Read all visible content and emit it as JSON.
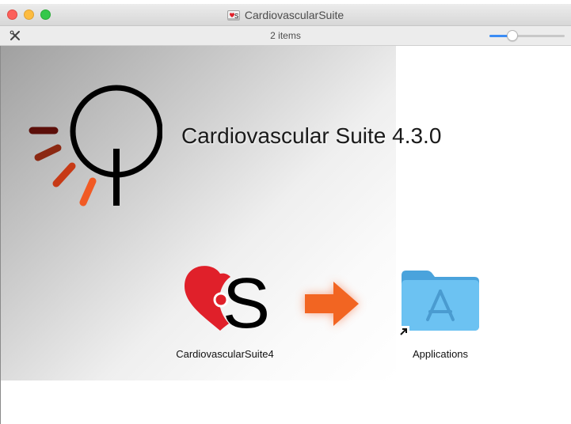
{
  "window": {
    "title": "CardiovascularSuite",
    "item_count": "2 items",
    "icon_size_slider": 0.3
  },
  "installer": {
    "product_title": "Cardiovascular Suite 4.3.0",
    "app_label": "CardiovascularSuite4",
    "folder_label": "Applications"
  },
  "colors": {
    "logo_ray_1": "#5c0f0a",
    "logo_ray_2": "#8b2812",
    "logo_ray_3": "#c73a16",
    "logo_ray_4": "#f15a24",
    "heart_red": "#e0202a",
    "arrow_orange": "#f26522",
    "folder_blue": "#5fb8ee",
    "slider_blue": "#3b8cf5"
  },
  "icons": [
    "close-button",
    "minimize-button",
    "zoom-button",
    "tools-icon",
    "cardio-logo",
    "app-icon",
    "arrow-icon",
    "applications-folder-icon",
    "alias-arrow-icon"
  ]
}
